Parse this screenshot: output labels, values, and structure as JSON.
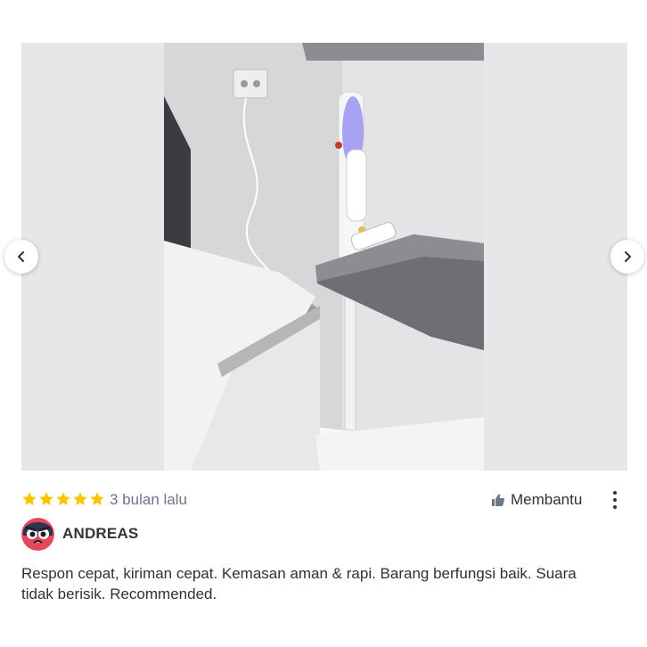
{
  "carousel": {
    "photo_icon": "product-photo",
    "prev_icon": "chevron-left-icon",
    "next_icon": "chevron-right-icon"
  },
  "review": {
    "rating": 5,
    "rating_max": 5,
    "star_color": "#ffc400",
    "time_ago": "3 bulan lalu",
    "helpful_label": "Membantu",
    "helpful_icon": "thumbs-up-icon",
    "more_icon": "more-vertical-icon",
    "reviewer_name": "ANDREAS",
    "avatar_icon": "avatar-icon",
    "text": "Respon cepat, kiriman cepat. Kemasan aman & rapi. Barang berfungsi baik. Suara tidak berisik. Recommended."
  }
}
